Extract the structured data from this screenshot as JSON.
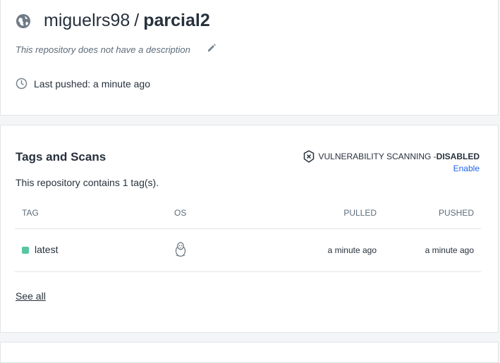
{
  "repo": {
    "owner": "miguelrs98",
    "separator": "/",
    "name": "parcial2",
    "description": "This repository does not have a description",
    "last_pushed": "Last pushed: a minute ago"
  },
  "tags_section": {
    "title": "Tags and Scans",
    "vuln_label": "VULNERABILITY SCANNING - ",
    "vuln_status": "DISABLED",
    "enable_label": "Enable",
    "tag_count_text": "This repository contains 1 tag(s).",
    "columns": [
      "TAG",
      "OS",
      "PULLED",
      "PUSHED"
    ],
    "rows": [
      {
        "tag": "latest",
        "os_icon": "linux-icon",
        "pulled": "a minute ago",
        "pushed": "a minute ago",
        "status_color": "#58c6a3"
      }
    ],
    "see_all_label": "See all"
  },
  "icons": {
    "visibility": "globe-icon",
    "edit": "pencil-icon",
    "time": "clock-icon",
    "scan": "shield-x-icon"
  },
  "colors": {
    "link": "#1d63ed",
    "tag_status": "#58c6a3"
  }
}
